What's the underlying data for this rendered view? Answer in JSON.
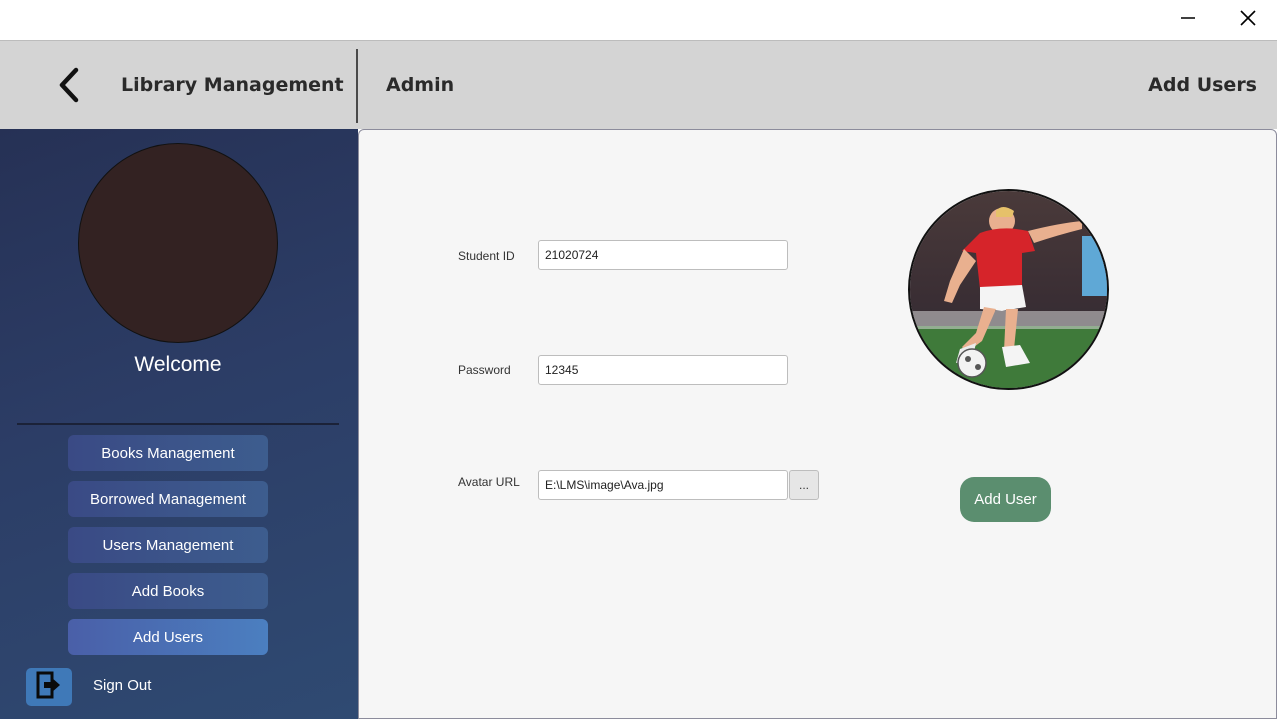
{
  "window": {
    "minimize_icon": "minimize-icon",
    "close_icon": "close-icon"
  },
  "header": {
    "back_icon": "chevron-left-icon",
    "app_title": "Library Management",
    "section": "Admin",
    "page": "Add Users"
  },
  "sidebar": {
    "welcome": "Welcome",
    "nav": [
      {
        "label": "Books Management"
      },
      {
        "label": "Borrowed Management"
      },
      {
        "label": "Users Management"
      },
      {
        "label": "Add Books"
      },
      {
        "label": "Add Users",
        "active": true
      }
    ],
    "signout_icon": "sign-out-icon",
    "signout_label": "Sign Out"
  },
  "form": {
    "student_id_label": "Student ID",
    "student_id_value": "21020724",
    "password_label": "Password",
    "password_value": "12345",
    "avatar_url_label": "Avatar URL",
    "avatar_url_value": "E:\\LMS\\image\\Ava.jpg",
    "browse_label": "...",
    "submit_label": "Add User"
  },
  "colors": {
    "header_bg": "#d4d4d4",
    "sidebar_bg": "#2c3d66",
    "main_bg": "#f6f6f6",
    "add_user_button": "#5b8e6f",
    "nav_active": "#4b7fc0"
  }
}
